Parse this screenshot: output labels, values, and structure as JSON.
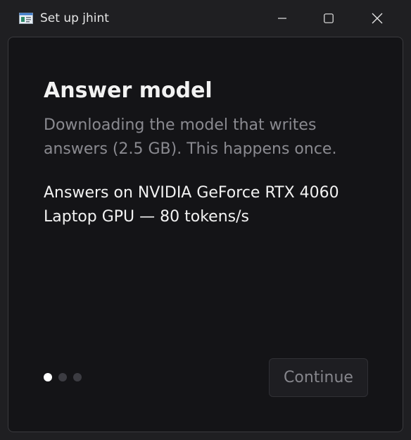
{
  "window": {
    "title": "Set up jhint",
    "app_icon": "app-window-icon",
    "controls": [
      "minimize-icon",
      "maximize-icon",
      "close-icon"
    ]
  },
  "page": {
    "heading": "Answer model",
    "subtitle": "Downloading the model that writes answers (2.5 GB). This happens once.",
    "info": "Answers on NVIDIA GeForce RTX 4060 Laptop GPU — 80 tokens/s"
  },
  "pager": {
    "total": 3,
    "current": 1
  },
  "actions": {
    "continue_label": "Continue",
    "continue_enabled": false
  },
  "colors": {
    "window_bg": "#1f1f22",
    "content_bg": "#141417",
    "heading": "#f2f2f2",
    "muted_text": "#8a8a90",
    "dot_active": "#ffffff",
    "dot_inactive": "#3c3c42"
  }
}
